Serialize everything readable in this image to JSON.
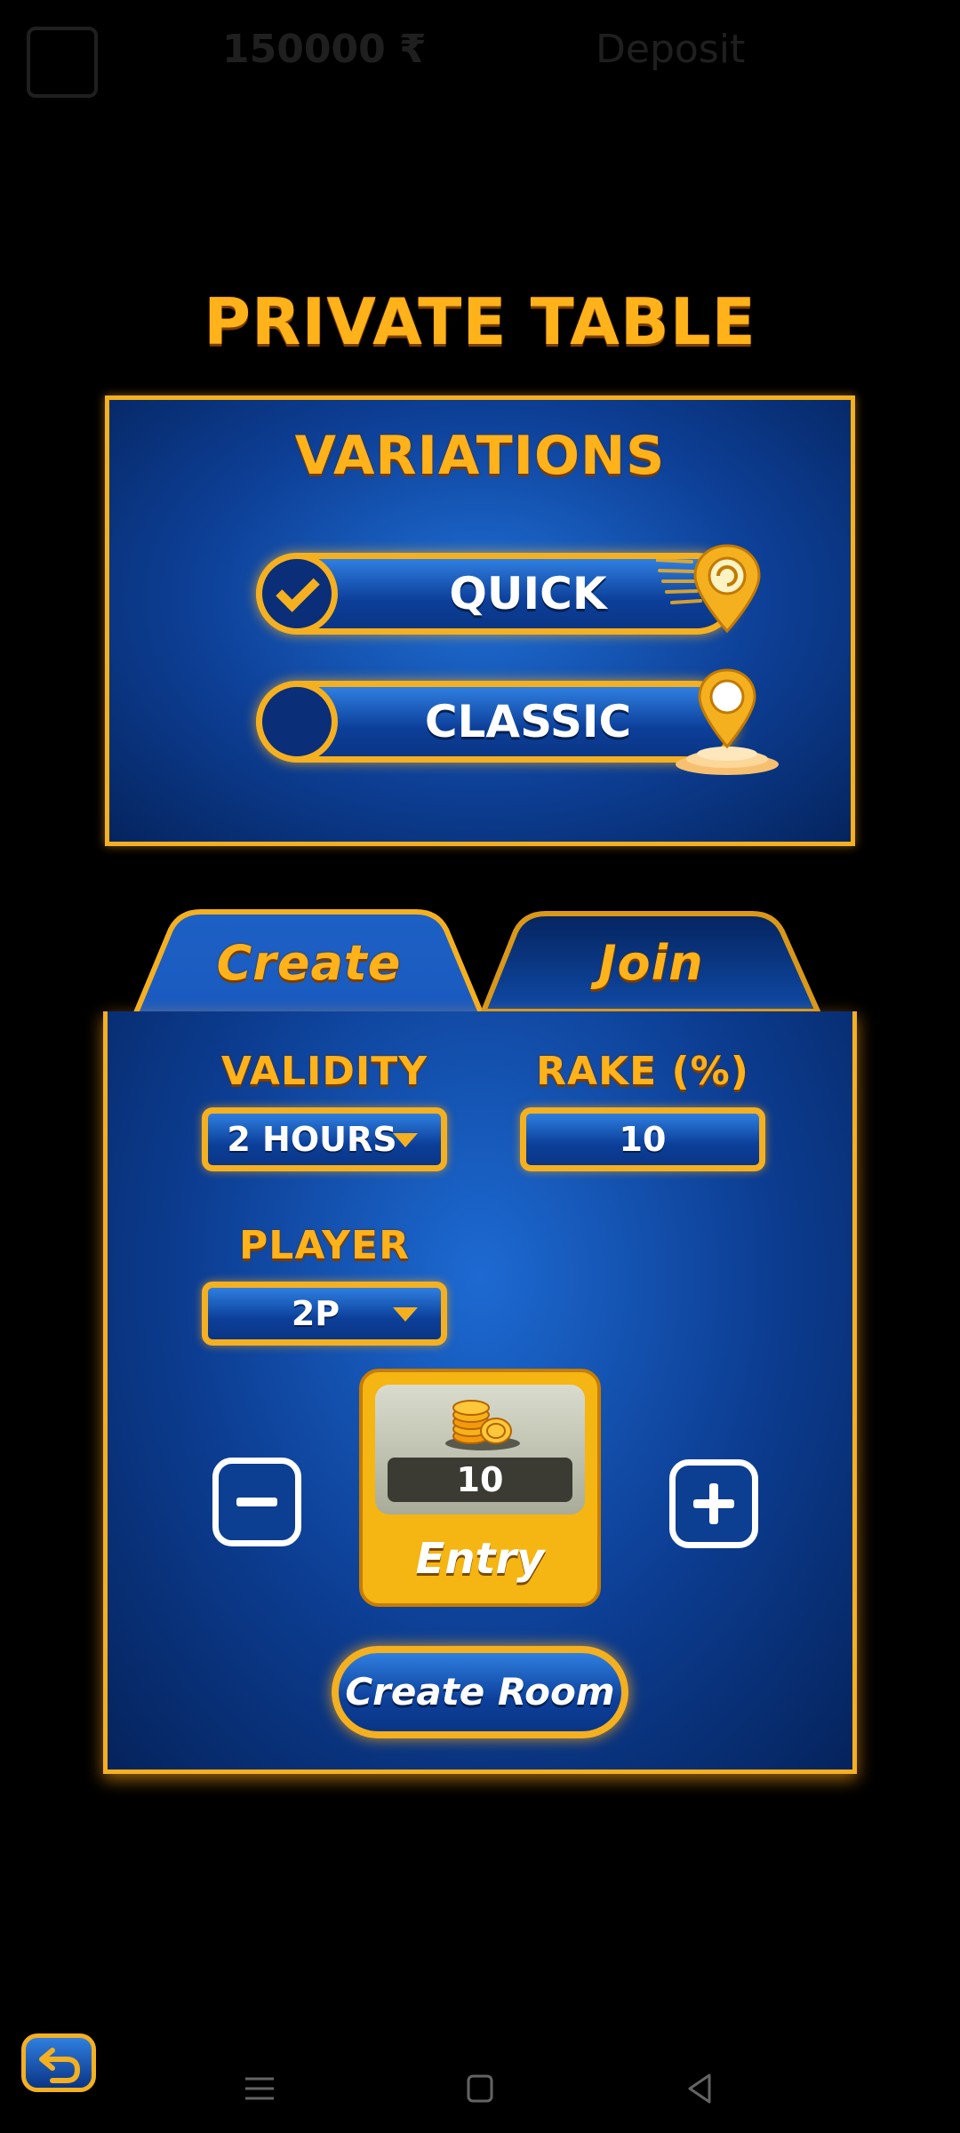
{
  "header": {
    "coins": "150000 ₹",
    "deposit": "Deposit"
  },
  "title": "PRIVATE TABLE",
  "variations": {
    "title": "VARIATIONS",
    "options": [
      {
        "label": "QUICK",
        "selected": true,
        "icon": "quick-location-pin-icon"
      },
      {
        "label": "CLASSIC",
        "selected": false,
        "icon": "classic-location-pin-icon"
      }
    ]
  },
  "tabs": {
    "create": "Create",
    "join": "Join",
    "active": "Create"
  },
  "create_form": {
    "validity_label": "VALIDITY",
    "validity_value": "2 HOURS",
    "rake_label": "RAKE (%)",
    "rake_value": "10",
    "player_label": "PLAYER",
    "player_value": "2P",
    "entry_value": "10",
    "entry_label": "Entry",
    "create_button": "Create Room"
  },
  "colors": {
    "accent_gold": "#f5b020",
    "panel_blue": "#0c3f9a",
    "background": "#000000"
  }
}
